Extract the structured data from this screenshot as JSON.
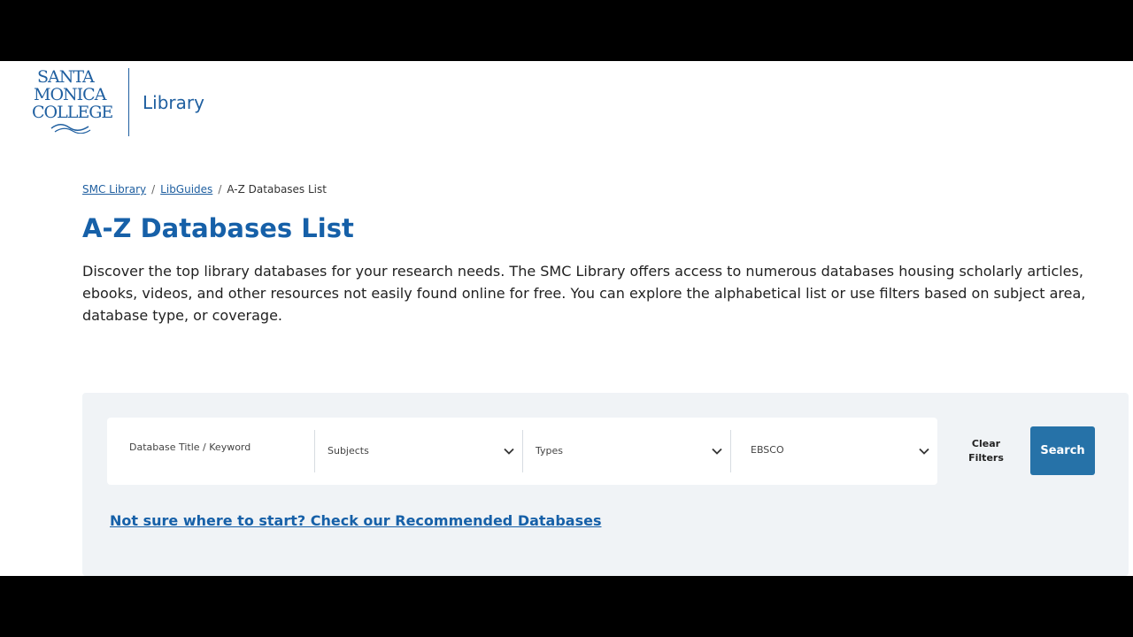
{
  "header": {
    "logo_lines": [
      "SANTA",
      "MONICA",
      "COLLEGE"
    ],
    "app_title": "Library"
  },
  "breadcrumb": {
    "items": [
      {
        "label": "SMC Library",
        "link": true
      },
      {
        "label": "LibGuides",
        "link": true
      },
      {
        "label": "A-Z Databases List",
        "link": false
      }
    ],
    "separator": "/"
  },
  "page": {
    "title": "A-Z Databases List",
    "intro": "Discover the top library databases for your research needs. The SMC Library offers access to numerous databases housing scholarly articles, ebooks, videos, and other resources not easily found online for free. You can explore the alphabetical list or use filters based on subject area, database type, or coverage."
  },
  "filters": {
    "keyword_placeholder": "Database Title / Keyword",
    "subjects_label": "Subjects",
    "types_label": "Types",
    "vendor_value": "EBSCO",
    "clear_label_line1": "Clear",
    "clear_label_line2": "Filters",
    "search_label": "Search",
    "recommend_link": "Not sure where to start? Check our Recommended Databases"
  },
  "colors": {
    "brand_blue": "#1660a8",
    "button_blue": "#2672a8",
    "panel_bg": "#f0f3f6"
  }
}
